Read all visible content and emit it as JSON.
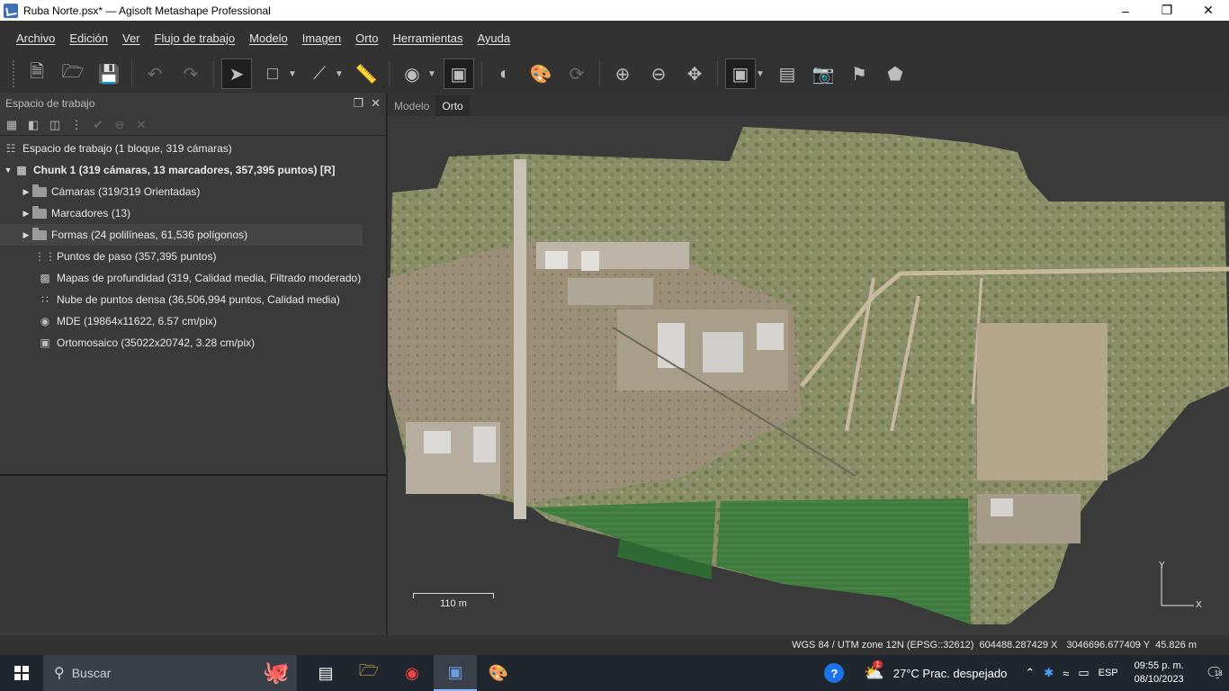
{
  "window": {
    "title": "Ruba Norte.psx* — Agisoft Metashape Professional"
  },
  "menu": [
    "Archivo",
    "Edición",
    "Ver",
    "Flujo de trabajo",
    "Modelo",
    "Imagen",
    "Orto",
    "Herramientas",
    "Ayuda"
  ],
  "workspace": {
    "header": "Espacio de trabajo",
    "root": "Espacio de trabajo (1 bloque, 319 cámaras)",
    "chunk": "Chunk 1 (319 cámaras, 13 marcadores, 357,395 puntos) [R]",
    "items": [
      {
        "label": "Cámaras (319/319 Orientadas)",
        "icon": "folder-icon",
        "expandable": true
      },
      {
        "label": "Marcadores (13)",
        "icon": "folder-icon",
        "expandable": true
      },
      {
        "label": "Formas (24 polilíneas, 61,536 polígonos)",
        "icon": "folder-icon",
        "expandable": true
      },
      {
        "label": "Puntos de paso (357,395 puntos)",
        "icon": "tie-points-icon",
        "expandable": false
      },
      {
        "label": "Mapas de profundidad (319, Calidad media, Filtrado moderado)",
        "icon": "depth-maps-icon",
        "expandable": false
      },
      {
        "label": "Nube de puntos densa (36,506,994 puntos, Calidad media)",
        "icon": "dense-cloud-icon",
        "expandable": false
      },
      {
        "label": "MDE (19864x11622, 6.57 cm/pix)",
        "icon": "dem-icon",
        "expandable": false
      },
      {
        "label": "Ortomosaico (35022x20742, 3.28 cm/pix)",
        "icon": "orthomosaic-icon",
        "expandable": false
      }
    ]
  },
  "tabs": [
    "Modelo",
    "Orto"
  ],
  "viewport": {
    "scale": "110 m",
    "axis_y": "Y",
    "axis_x": "X"
  },
  "status": {
    "crs": "WGS 84 / UTM zone 12N (EPSG::32612)",
    "x": "604488.287429 X",
    "y": "3046696.677409 Y",
    "z": "45.826 m"
  },
  "taskbar": {
    "search": "Buscar",
    "weather": "27°C  Prac. despejado",
    "lang": "ESP",
    "time": "09:55 p. m.",
    "date": "08/10/2023",
    "notif": "18",
    "weather_badge": "1"
  }
}
